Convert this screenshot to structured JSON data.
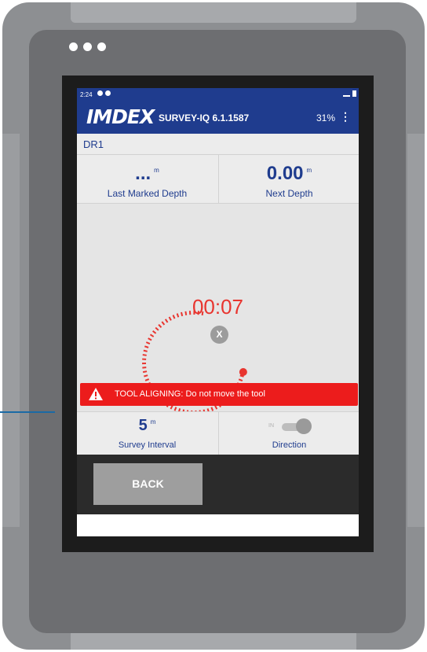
{
  "status_bar": {
    "time": "2:24"
  },
  "app_bar": {
    "logo": "IMDEX",
    "title": "SURVEY-IQ 6.1.1587",
    "battery": "31%",
    "menu_icon": "overflow-menu-icon"
  },
  "drill": {
    "name": "DR1"
  },
  "depth": {
    "last_marked_value": "...",
    "last_marked_unit": "m",
    "last_marked_label": "Last Marked Depth",
    "next_value": "0.00",
    "next_unit": "m",
    "next_label": "Next Depth"
  },
  "timer": {
    "value": "00:07",
    "cancel_label": "X",
    "progress_fraction": 0.47,
    "color": "#e8352f"
  },
  "alert": {
    "icon": "warning-icon",
    "text": "TOOL ALIGNING: Do not move the tool",
    "color": "#ec1c1c"
  },
  "survey": {
    "interval_value": "5",
    "interval_unit": "m",
    "interval_label": "Survey Interval",
    "direction_toggle_label": "IN",
    "direction_label": "Direction"
  },
  "actions": {
    "back_label": "BACK"
  },
  "colors": {
    "brand_blue": "#1f3c8e",
    "device_gray": "#6d6e71"
  }
}
